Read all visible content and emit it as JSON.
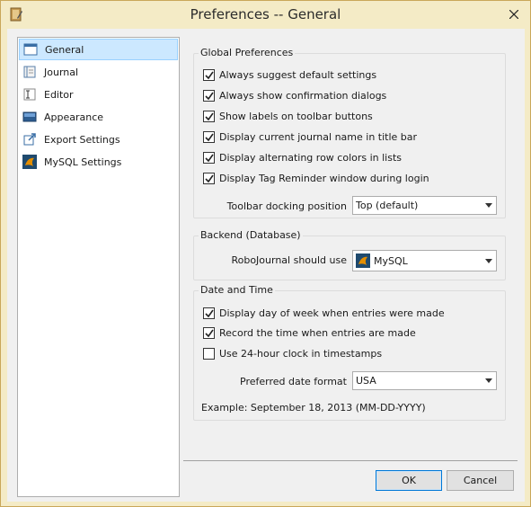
{
  "window": {
    "title": "Preferences -- General"
  },
  "sidebar": {
    "items": [
      {
        "label": "General",
        "icon": "window-icon",
        "selected": true
      },
      {
        "label": "Journal",
        "icon": "book-icon"
      },
      {
        "label": "Editor",
        "icon": "text-editor-icon"
      },
      {
        "label": "Appearance",
        "icon": "monitor-icon"
      },
      {
        "label": "Export Settings",
        "icon": "export-arrow-icon"
      },
      {
        "label": "MySQL Settings",
        "icon": "mysql-dolphin-icon"
      }
    ]
  },
  "global": {
    "title": "Global Preferences",
    "options": [
      {
        "label": "Always suggest default settings",
        "checked": true
      },
      {
        "label": "Always show confirmation dialogs",
        "checked": true
      },
      {
        "label": "Show labels on toolbar buttons",
        "checked": true
      },
      {
        "label": "Display current journal name in title bar",
        "checked": true
      },
      {
        "label": "Display alternating row colors in lists",
        "checked": true
      },
      {
        "label": "Display Tag Reminder window during login",
        "checked": true
      }
    ],
    "toolbar_docking_label": "Toolbar docking position",
    "toolbar_docking_value": "Top (default)"
  },
  "backend": {
    "title": "Backend (Database)",
    "label": "RoboJournal should use",
    "value": "MySQL",
    "value_icon": "mysql-dolphin-icon"
  },
  "datetime": {
    "title": "Date and Time",
    "options": [
      {
        "label": "Display day of week when entries were made",
        "checked": true
      },
      {
        "label": "Record the time when entries are made",
        "checked": true
      },
      {
        "label": "Use 24-hour clock in timestamps",
        "checked": false
      }
    ],
    "date_format_label": "Preferred date format",
    "date_format_value": "USA",
    "example": "Example: September 18, 2013 (MM-DD-YYYY)"
  },
  "buttons": {
    "ok": "OK",
    "cancel": "Cancel"
  },
  "colors": {
    "selection": "#cce8ff",
    "selection_border": "#99d1ff",
    "frame": "#f4ebc6",
    "default_button_border": "#0078d7"
  }
}
